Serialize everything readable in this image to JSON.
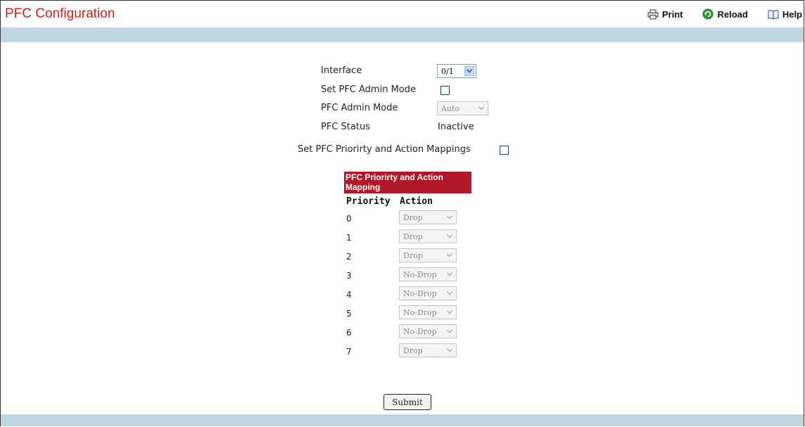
{
  "header": {
    "title": "PFC Configuration",
    "tools": {
      "print_label": "Print",
      "reload_label": "Reload",
      "help_label": "Help"
    }
  },
  "form": {
    "interface_label": "Interface",
    "interface_value": "0/1",
    "set_admin_mode_label": "Set PFC Admin Mode",
    "admin_mode_label": "PFC Admin Mode",
    "admin_mode_value": "Auto",
    "status_label": "PFC Status",
    "status_value": "Inactive",
    "set_mappings_label": "Set PFC Priorirty and Action Mappings"
  },
  "mapping": {
    "title": "PFC Priorirty and Action Mapping",
    "col_priority": "Priority",
    "col_action": "Action",
    "rows": [
      {
        "priority": "0",
        "action": "Drop"
      },
      {
        "priority": "1",
        "action": "Drop"
      },
      {
        "priority": "2",
        "action": "Drop"
      },
      {
        "priority": "3",
        "action": "No-Drop"
      },
      {
        "priority": "4",
        "action": "No-Drop"
      },
      {
        "priority": "5",
        "action": "No-Drop"
      },
      {
        "priority": "6",
        "action": "No-Drop"
      },
      {
        "priority": "7",
        "action": "Drop"
      }
    ]
  },
  "submit_label": "Submit",
  "colors": {
    "title": "#e01818",
    "band": "#bfd6e3",
    "mapping_header": "#b3182a"
  }
}
